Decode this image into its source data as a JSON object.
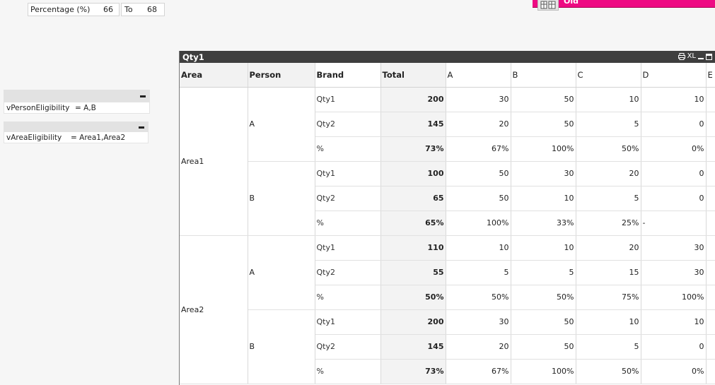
{
  "filter": {
    "label": "Percentage (%)",
    "from": "66",
    "to_label": "To",
    "to": "68"
  },
  "top_tab": {
    "label": "Old",
    "color": "#ee0a83"
  },
  "variables": [
    {
      "name": "vPersonEligibility",
      "value": "= A,B"
    },
    {
      "name": "vAreaEligibility",
      "value": "= Area1,Area2"
    }
  ],
  "table": {
    "title": "Qty1",
    "caption_icons": [
      "print-icon",
      "xl-icon",
      "minimize-icon",
      "maximize-icon"
    ],
    "xl_label": "XL",
    "headers": [
      "Area",
      "Person",
      "Brand",
      "Total",
      "A",
      "B",
      "C",
      "D",
      "E"
    ],
    "areas": [
      {
        "name": "Area1",
        "persons": [
          {
            "name": "A",
            "rows": [
              {
                "brand": "Qty1",
                "total": "200",
                "values": [
                  "30",
                  "50",
                  "10",
                  "10",
                  ""
                ]
              },
              {
                "brand": "Qty2",
                "total": "145",
                "values": [
                  "20",
                  "50",
                  "5",
                  "0",
                  ""
                ]
              },
              {
                "brand": "%",
                "total": "73%",
                "values": [
                  "67%",
                  "100%",
                  "50%",
                  "0%",
                  ""
                ]
              }
            ]
          },
          {
            "name": "B",
            "rows": [
              {
                "brand": "Qty1",
                "total": "100",
                "values": [
                  "50",
                  "30",
                  "20",
                  "0",
                  ""
                ]
              },
              {
                "brand": "Qty2",
                "total": "65",
                "values": [
                  "50",
                  "10",
                  "5",
                  "0",
                  ""
                ]
              },
              {
                "brand": "%",
                "total": "65%",
                "values": [
                  "100%",
                  "33%",
                  "25%",
                  "-",
                  "-"
                ]
              }
            ]
          }
        ]
      },
      {
        "name": "Area2",
        "persons": [
          {
            "name": "A",
            "rows": [
              {
                "brand": "Qty1",
                "total": "110",
                "values": [
                  "10",
                  "10",
                  "20",
                  "30",
                  ""
                ]
              },
              {
                "brand": "Qty2",
                "total": "55",
                "values": [
                  "5",
                  "5",
                  "15",
                  "30",
                  ""
                ]
              },
              {
                "brand": "%",
                "total": "50%",
                "values": [
                  "50%",
                  "50%",
                  "75%",
                  "100%",
                  ""
                ]
              }
            ]
          },
          {
            "name": "B",
            "rows": [
              {
                "brand": "Qty1",
                "total": "200",
                "values": [
                  "30",
                  "50",
                  "10",
                  "10",
                  ""
                ]
              },
              {
                "brand": "Qty2",
                "total": "145",
                "values": [
                  "20",
                  "50",
                  "5",
                  "0",
                  ""
                ]
              },
              {
                "brand": "%",
                "total": "73%",
                "values": [
                  "67%",
                  "100%",
                  "50%",
                  "0%",
                  ""
                ]
              }
            ]
          }
        ]
      }
    ]
  }
}
